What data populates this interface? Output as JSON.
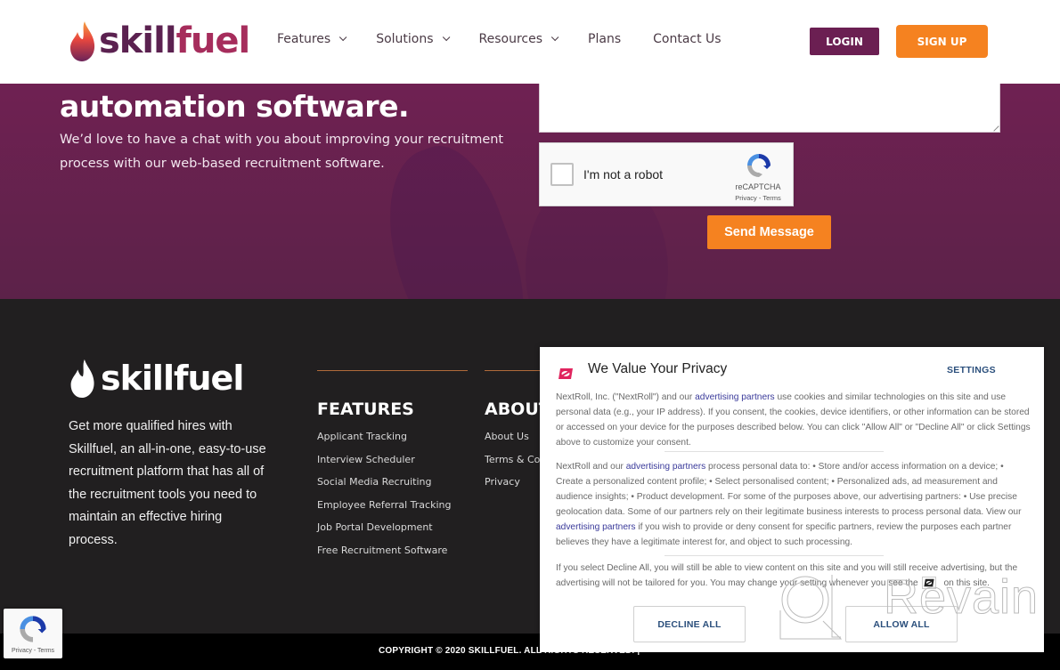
{
  "header": {
    "logo_text_a": "skill",
    "logo_text_b": "fuel",
    "nav": [
      {
        "label": "Features",
        "has_dropdown": true
      },
      {
        "label": "Solutions",
        "has_dropdown": true
      },
      {
        "label": "Resources",
        "has_dropdown": true
      },
      {
        "label": "Plans",
        "has_dropdown": false
      },
      {
        "label": "Contact Us",
        "has_dropdown": false
      }
    ],
    "login_label": "LOGIN",
    "signup_label": "SIGN UP"
  },
  "hero": {
    "title": "automation software.",
    "subtitle": "We’d love to have a chat with you about improving your recruitment process with our web-based recruitment software.",
    "message_value": "",
    "recaptcha": {
      "label": "I'm not a robot",
      "brand": "reCAPTCHA",
      "links": "Privacy - Terms",
      "checked": false
    },
    "send_label": "Send Message"
  },
  "footer": {
    "logo_text": "skillfuel",
    "about_text": "Get more qualified hires with Skillfuel, an all-in-one, easy-to-use recruitment platform that has all of the recruitment tools you need to maintain an effective hiring process.",
    "columns": [
      {
        "heading": "FEATURES",
        "links": [
          "Applicant Tracking",
          "Interview Scheduler",
          "Social Media Recruiting",
          "Employee Referral Tracking",
          "Job Portal Development",
          "Free Recruitment Software"
        ]
      },
      {
        "heading": "ABOUT",
        "links": [
          "About Us",
          "Terms & Conditions",
          "Privacy"
        ]
      }
    ],
    "copyright": "COPYRIGHT © 2020 SKILLFUEL. ALL RIGHTS RESERVED. |"
  },
  "recaptcha_badge": {
    "links": "Privacy - Terms"
  },
  "privacy_dialog": {
    "title": "We Value Your Privacy",
    "settings_label": "SETTINGS",
    "p1_before": "NextRoll, Inc. (\"NextRoll\") and our ",
    "p1_link": "advertising partners",
    "p1_after": " use cookies and similar technologies on this site and use personal data (e.g., your IP address). If you consent, the cookies, device identifiers, or other information can be stored or accessed on your device for the purposes described below. You can click \"Allow All\" or \"Decline All\" or click Settings above to customize your consent.",
    "p2_before": "NextRoll and our ",
    "p2_link": "advertising partners",
    "p2_mid": " process personal data to: • Store and/or access information on a device; • Create a personalized content profile; • Select personalised content; • Personalized ads, ad measurement and audience insights; • Product development. For some of the purposes above, our advertising partners: • Use precise geolocation data. Some of our partners rely on their legitimate business interests to process personal data. View our ",
    "p2_link2": "advertising partners",
    "p2_after": " if you wish to provide or deny consent for specific partners, review the purposes each partner believes they have a legitimate interest for, and object to such processing.",
    "p3_before": "If you select Decline All, you will still be able to view content on this site and you will still receive advertising, but the advertising will not be tailored for you. You may change your setting whenever you see the",
    "p3_after": "on this site.",
    "decline_label": "DECLINE ALL",
    "allow_label": "ALLOW ALL"
  },
  "watermark": {
    "text": "Revain"
  },
  "colors": {
    "brand_purple": "#6b1f52",
    "brand_orange": "#f58220",
    "footer_bg": "#211f20",
    "nextroll_red": "#e0245e",
    "link_blue": "#2b4f7c"
  }
}
